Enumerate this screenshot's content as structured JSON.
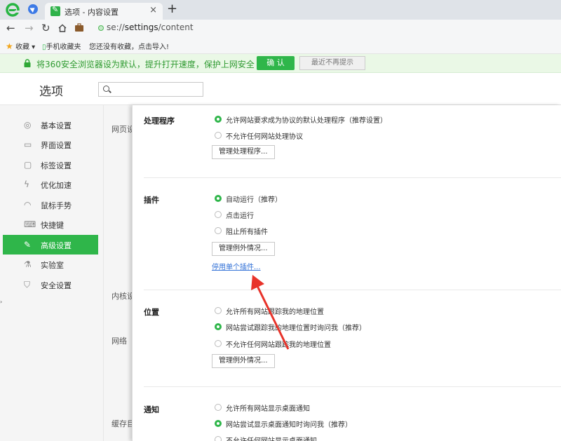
{
  "browser": {
    "tab_title": "选项 - 内容设置",
    "tab_close": "×",
    "new_tab": "+",
    "url_scheme": "se://",
    "url_host": "settings",
    "url_path": "/content"
  },
  "bookmarks": {
    "favorites_label": "收藏",
    "mobile_label": "手机收藏夹",
    "import_hint": "您还没有收藏，点击导入!"
  },
  "infobar": {
    "message": "将360安全浏览器设为默认，提升打开速度，保护上网安全",
    "confirm_label": "确 认",
    "dismiss_label": "最近不再提示"
  },
  "settings": {
    "title": "选项",
    "search_placeholder": ""
  },
  "sidebar": {
    "items": [
      {
        "label": "基本设置",
        "icon": "◎"
      },
      {
        "label": "界面设置",
        "icon": "▭"
      },
      {
        "label": "标签设置",
        "icon": "▢"
      },
      {
        "label": "优化加速",
        "icon": "ϟ"
      },
      {
        "label": "鼠标手势",
        "icon": "◠"
      },
      {
        "label": "快捷键",
        "icon": "⌨"
      },
      {
        "label": "高级设置",
        "icon": "✎",
        "active": true
      },
      {
        "label": "实验室",
        "icon": "⚗"
      },
      {
        "label": "安全设置",
        "icon": "⛉"
      }
    ]
  },
  "categories": [
    "网页设",
    "内核设",
    "网络",
    "缓存目"
  ],
  "panel": {
    "handlers": {
      "title": "处理程序",
      "options": [
        "允许网站要求成为协议的默认处理程序（推荐设置）",
        "不允许任何网站处理协议"
      ],
      "selected": 0,
      "button": "管理处理程序..."
    },
    "plugins": {
      "title": "插件",
      "options": [
        "自动运行（推荐）",
        "点击运行",
        "阻止所有插件"
      ],
      "selected": 0,
      "button": "管理例外情况...",
      "link": "停用单个插件..."
    },
    "location": {
      "title": "位置",
      "options": [
        "允许所有网站跟踪我的地理位置",
        "网站尝试跟踪我的地理位置时询问我（推荐）",
        "不允许任何网站跟踪我的地理位置"
      ],
      "selected": 1,
      "button": "管理例外情况..."
    },
    "notifications": {
      "title": "通知",
      "options": [
        "允许所有网站显示桌面通知",
        "网站尝试显示桌面通知时询问我（推荐）",
        "不允许任何网站显示桌面通知"
      ],
      "selected": 1
    }
  },
  "colors": {
    "accent_green": "#2fb64a",
    "link_blue": "#2f6fd6",
    "annotation_red": "#e8332a"
  }
}
